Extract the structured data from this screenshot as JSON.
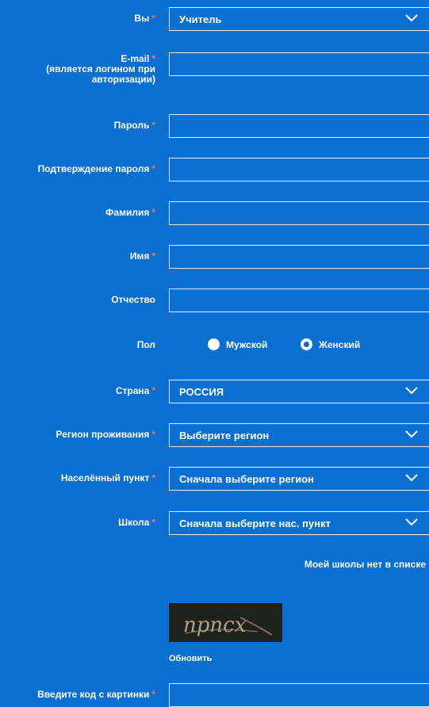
{
  "form": {
    "role": {
      "label": "Вы",
      "value": "Учитель"
    },
    "email": {
      "label_line1": "E-mail",
      "label_line2": "(является логином при",
      "label_line3": "авторизации)",
      "value": ""
    },
    "password": {
      "label": "Пароль",
      "value": ""
    },
    "password_confirm": {
      "label": "Подтверждение пароля",
      "value": ""
    },
    "last_name": {
      "label": "Фамилия",
      "value": ""
    },
    "first_name": {
      "label": "Имя",
      "value": ""
    },
    "middle_name": {
      "label": "Отчество",
      "value": ""
    },
    "gender": {
      "label": "Пол",
      "male": "Мужской",
      "female": "Женский"
    },
    "country": {
      "label": "Страна",
      "value": "РОССИЯ"
    },
    "region": {
      "label": "Регион проживания",
      "value": "Выберите регион"
    },
    "city": {
      "label": "Населённый пункт",
      "value": "Сначала выберите регион"
    },
    "school": {
      "label": "Школа",
      "value": "Сначала выберите нас. пункт"
    },
    "no_school_link": "Моей школы нет в списке",
    "captcha": {
      "text": "прпсх",
      "refresh": "Обновить",
      "input_label": "Введите код с картинки",
      "value": ""
    },
    "required_mark": "*"
  },
  "colors": {
    "background": "#0b6fd0",
    "required": "#ff6a6a"
  },
  "icons": {
    "select": "chevron-down-icon",
    "gender_male": "radio-filled",
    "gender_female": "radio-selected"
  }
}
